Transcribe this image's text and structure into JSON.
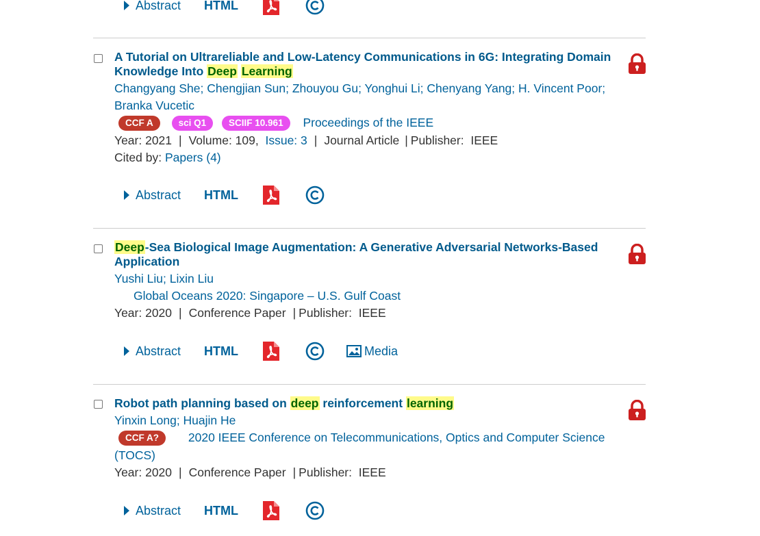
{
  "common": {
    "abstract_label": "Abstract",
    "html_label": "HTML",
    "media_label": "Media",
    "year_prefix": "Year: ",
    "publisher_prefix": "Publisher: ",
    "cited_prefix": "Cited by: "
  },
  "results": [
    {
      "title_parts": [
        "A Tutorial on Ultrareliable and Low-Latency Communications in 6G: Integrating Domain Knowledge Into ",
        "Deep",
        "Learning"
      ],
      "authors": [
        "Changyang She",
        "Chengjian Sun",
        "Zhouyou Gu",
        "Yonghui Li",
        "Chenyang Yang",
        "H. Vincent Poor",
        "Branka Vucetic"
      ],
      "badges": [
        "CCF A",
        "sci Q1",
        "SCIIF 10.961"
      ],
      "venue": "Proceedings of the IEEE",
      "year": "2021",
      "volume_label": "Volume: 109,",
      "issue_label": "Issue: 3",
      "type": "Journal Article",
      "publisher": "IEEE",
      "cited_link": "Papers (4)"
    },
    {
      "title_parts": [
        "Deep",
        "-Sea Biological Image Augmentation: A Generative Adversarial Networks-Based Application"
      ],
      "authors": [
        "Yushi Liu",
        "Lixin Liu"
      ],
      "venue": "Global Oceans 2020: Singapore – U.S. Gulf Coast",
      "year": "2020",
      "type": "Conference Paper",
      "publisher": "IEEE"
    },
    {
      "title_parts": [
        "Robot path planning based on ",
        "deep",
        " reinforcement ",
        "learning"
      ],
      "authors": [
        "Yinxin Long",
        "Huajin He"
      ],
      "badges": [
        "CCF A?"
      ],
      "venue_line1": "2020 IEEE Conference on Telecommunications, Optics and Computer Science",
      "venue_line2": "(TOCS)",
      "year": "2020",
      "type": "Conference Paper",
      "publisher": "IEEE"
    }
  ],
  "colors": {
    "link": "#00629b",
    "highlight": "#fffb8a",
    "lock": "#cc1f1f",
    "ccf_badge": "#c0392b",
    "sci_badge": "#e84ff0"
  }
}
